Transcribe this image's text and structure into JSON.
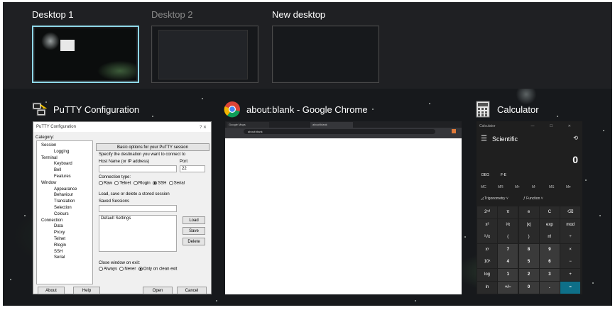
{
  "desktops": [
    {
      "name": "Desktop 1",
      "active": true
    },
    {
      "name": "Desktop 2",
      "active": false
    },
    {
      "name": "New desktop",
      "active": false
    }
  ],
  "windows": {
    "putty": {
      "title": "PuTTY Configuration",
      "inner_title": "PuTTY Configuration",
      "title_controls": "?   ✕",
      "category_label": "Category:",
      "tree": [
        "Session",
        "Logging",
        "Terminal",
        "Keyboard",
        "Bell",
        "Features",
        "Window",
        "Appearance",
        "Behaviour",
        "Translation",
        "Selection",
        "Colours",
        "Connection",
        "Data",
        "Proxy",
        "Telnet",
        "Rlogin",
        "SSH",
        "Serial"
      ],
      "panel_header": "Basic options for your PuTTY session",
      "dest_label": "Specify the destination you want to connect to",
      "host_label": "Host Name (or IP address)",
      "port_label": "Port",
      "port_value": "22",
      "conn_type_label": "Connection type:",
      "conn_types": [
        "Raw",
        "Telnet",
        "Rlogin",
        "SSH",
        "Serial"
      ],
      "selected_conn_type": "SSH",
      "load_save_label": "Load, save or delete a stored session",
      "saved_sessions_label": "Saved Sessions",
      "session_list": [
        "Default Settings"
      ],
      "load_button": "Load",
      "save_button": "Save",
      "delete_button": "Delete",
      "close_window_label": "Close window on exit:",
      "close_options": [
        "Always",
        "Never",
        "Only on clean exit"
      ],
      "selected_close_option": "Only on clean exit",
      "about_button": "About",
      "help_button": "Help",
      "open_button": "Open",
      "cancel_button": "Cancel"
    },
    "chrome": {
      "title": "about:blank - Google Chrome",
      "tabs": [
        "Google Maps",
        "about:blank"
      ],
      "url": "about:blank"
    },
    "calculator": {
      "title": "Calculator",
      "inner_title": "Calculator",
      "title_controls": "— ☐ ✕",
      "mode": "Scientific",
      "display_value": "0",
      "angle_units": "DEG",
      "fe_label": "F-E",
      "memory": [
        "MC",
        "MR",
        "M+",
        "M-",
        "MS",
        "M▾"
      ],
      "trig_label": "Trigonometry",
      "func_label": "Function",
      "keys": [
        [
          "2ⁿᵈ",
          "π",
          "e",
          "C",
          "⌫"
        ],
        [
          "x²",
          "¹⁄x",
          "|x|",
          "exp",
          "mod"
        ],
        [
          "²√x",
          "(",
          ")",
          "n!",
          "÷"
        ],
        [
          "xʸ",
          "7",
          "8",
          "9",
          "×"
        ],
        [
          "10ˣ",
          "4",
          "5",
          "6",
          "−"
        ],
        [
          "log",
          "1",
          "2",
          "3",
          "+"
        ],
        [
          "ln",
          "+/−",
          "0",
          ".",
          "="
        ]
      ]
    }
  },
  "colors": {
    "active_border": "#8fd8e8",
    "equals_key": "#0e6f88",
    "background": "#1c1e22"
  }
}
